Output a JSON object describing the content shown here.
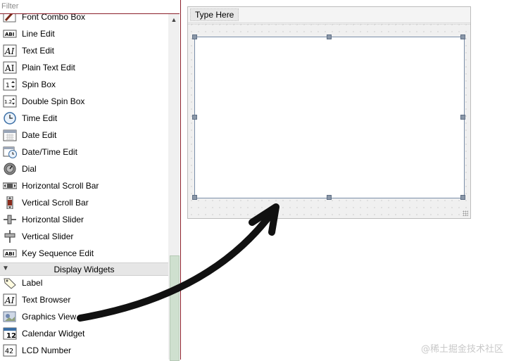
{
  "filter": {
    "placeholder": "Filter"
  },
  "widgets": [
    {
      "label": "Font Combo Box",
      "icon": "font-combo-box-icon"
    },
    {
      "label": "Line Edit",
      "icon": "line-edit-icon"
    },
    {
      "label": "Text Edit",
      "icon": "text-edit-icon"
    },
    {
      "label": "Plain Text Edit",
      "icon": "plain-text-edit-icon"
    },
    {
      "label": "Spin Box",
      "icon": "spin-box-icon"
    },
    {
      "label": "Double Spin Box",
      "icon": "double-spin-box-icon"
    },
    {
      "label": "Time Edit",
      "icon": "clock-icon"
    },
    {
      "label": "Date Edit",
      "icon": "calendar-icon"
    },
    {
      "label": "Date/Time Edit",
      "icon": "calendar-clock-icon"
    },
    {
      "label": "Dial",
      "icon": "dial-icon"
    },
    {
      "label": "Horizontal Scroll Bar",
      "icon": "horizontal-scroll-bar-icon"
    },
    {
      "label": "Vertical Scroll Bar",
      "icon": "vertical-scroll-bar-icon"
    },
    {
      "label": "Horizontal Slider",
      "icon": "horizontal-slider-icon"
    },
    {
      "label": "Vertical Slider",
      "icon": "vertical-slider-icon"
    },
    {
      "label": "Key Sequence Edit",
      "icon": "key-sequence-edit-icon"
    }
  ],
  "category": {
    "label": "Display Widgets",
    "expanded": true
  },
  "display_widgets": [
    {
      "label": "Label",
      "icon": "label-tag-icon"
    },
    {
      "label": "Text Browser",
      "icon": "text-browser-icon"
    },
    {
      "label": "Graphics View",
      "icon": "graphics-view-icon"
    },
    {
      "label": "Calendar Widget",
      "icon": "calendar-widget-icon"
    },
    {
      "label": "LCD Number",
      "icon": "lcd-number-icon"
    }
  ],
  "form": {
    "menu_placeholder": "Type Here"
  },
  "watermark": "@稀土掘金技术社区",
  "colors": {
    "panel_border": "#8b1f2a",
    "arrow": "#111111",
    "selection_border": "#7a8ea8"
  }
}
